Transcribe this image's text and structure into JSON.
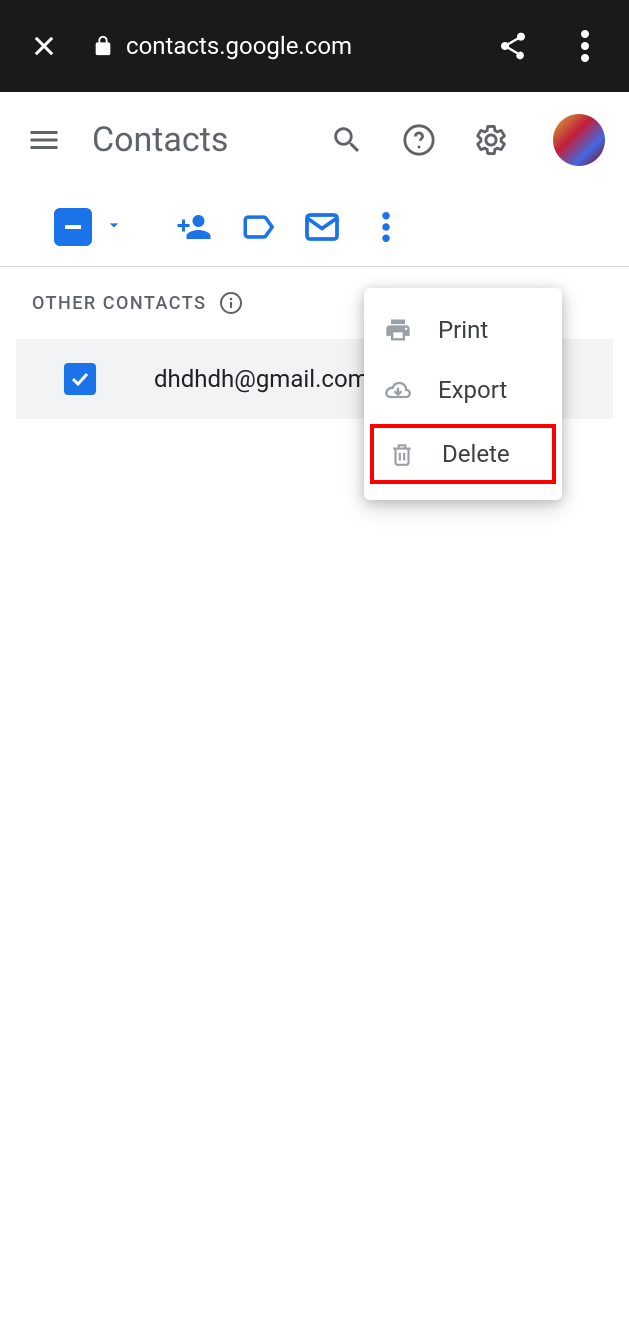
{
  "browser": {
    "url": "contacts.google.com"
  },
  "header": {
    "title": "Contacts"
  },
  "section": {
    "title": "OTHER CONTACTS"
  },
  "contact": {
    "email": "dhdhdh@gmail.com"
  },
  "menu": {
    "print": "Print",
    "export": "Export",
    "delete": "Delete"
  }
}
